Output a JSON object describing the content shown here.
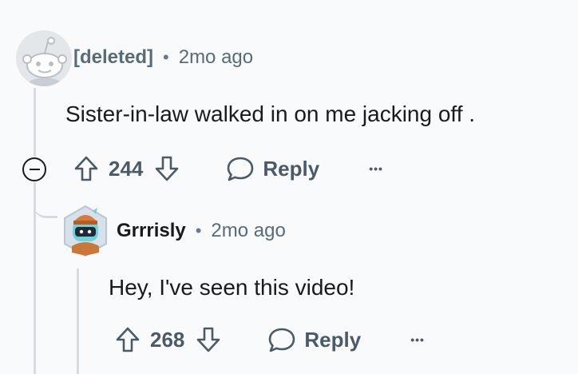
{
  "comments": [
    {
      "author": "[deleted]",
      "separator": "•",
      "time": "2mo ago",
      "body": "Sister-in-law walked in on me jacking off .",
      "score": "244",
      "reply_label": "Reply",
      "more_label": "•••"
    },
    {
      "author": "Grrrisly",
      "separator": "•",
      "time": "2mo ago",
      "body": "Hey, I've seen this video!",
      "score": "268",
      "reply_label": "Reply",
      "more_label": "•••"
    }
  ],
  "icons": {
    "collapse": "collapse-thread-icon",
    "upvote": "upvote-arrow-icon",
    "downvote": "downvote-arrow-icon",
    "reply": "speech-bubble-icon",
    "more": "more-options-icon"
  },
  "colors": {
    "background": "#f8fafc",
    "thread_line": "#d6dbe0",
    "meta_text": "#5a6b78",
    "action_text": "#4c5a66"
  }
}
